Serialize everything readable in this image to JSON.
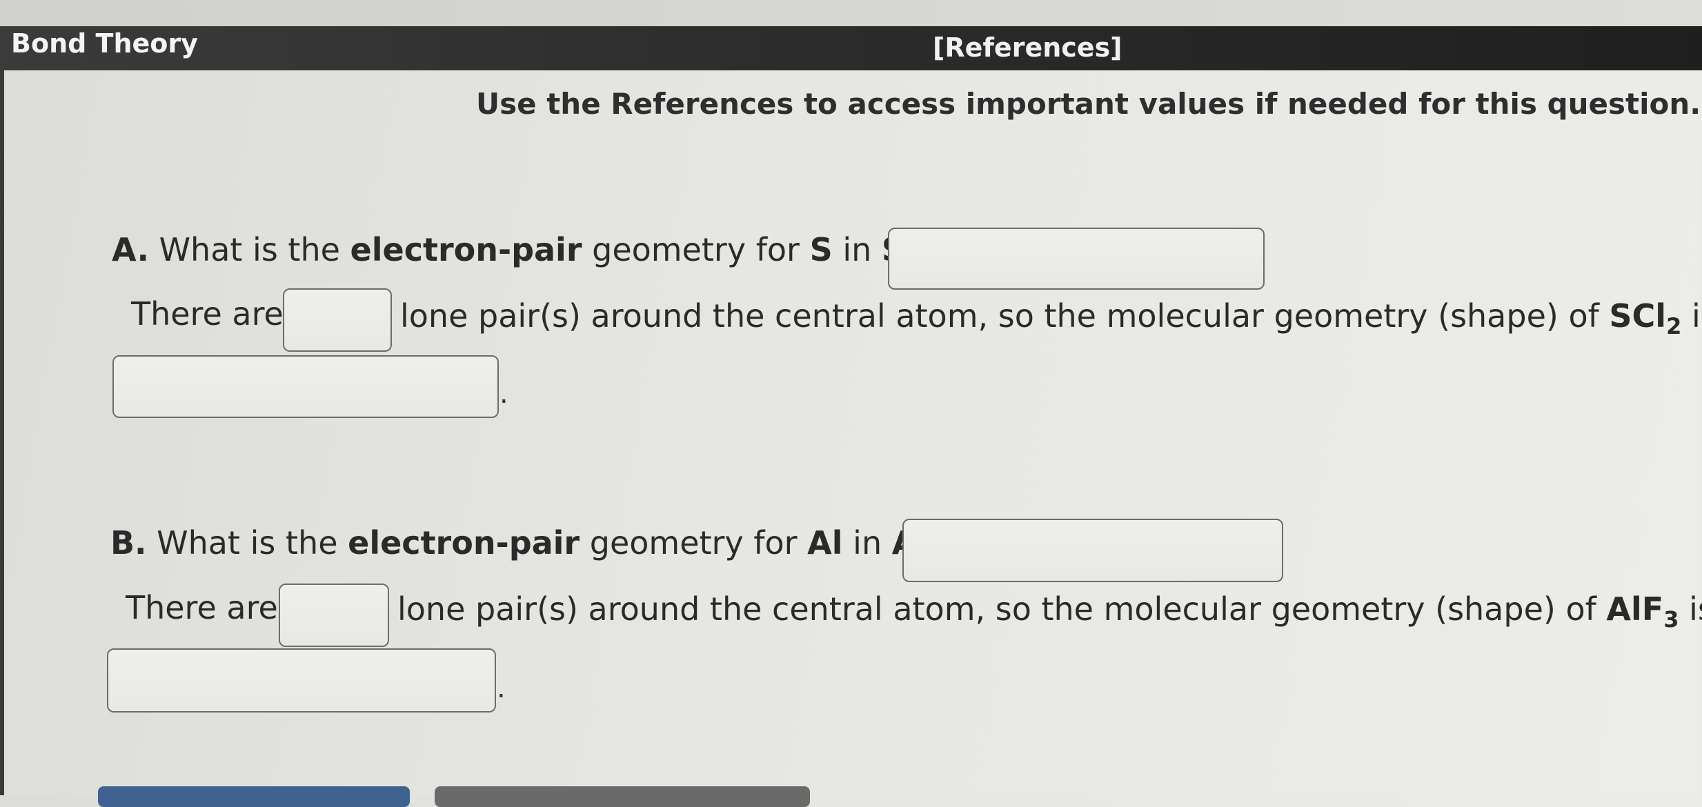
{
  "header": {
    "title": "Bond Theory",
    "references_link": "[References]"
  },
  "instructions": "Use the References to access important values if needed for this question.",
  "part_a": {
    "label": "A.",
    "q1_pre": "What is the",
    "q1_bold": "electron-pair",
    "q1_mid": "geometry for",
    "atom": "S",
    "q1_in": "in",
    "molecule": "SCl",
    "subscript": "2",
    "qmark": "?",
    "there_are": "There are",
    "lone_pairs_text": "lone pair(s) around the central atom, so the molecular geometry (shape) of",
    "is": "is",
    "period": "."
  },
  "part_b": {
    "label": "B.",
    "q1_pre": "What is the",
    "q1_bold": "electron-pair",
    "q1_mid": "geometry for",
    "atom": "Al",
    "q1_in": "in",
    "molecule": "AlF",
    "subscript": "3",
    "qmark": "?",
    "there_are": "There are",
    "lone_pairs_text": "lone pair(s) around the central atom, so the molecular geometry (shape) of",
    "is": "is",
    "period": "."
  },
  "colors": {
    "header_bg": "#2e2e2e",
    "page_bg": "#e6e6e2",
    "button_blue": "#3f6290",
    "button_gray": "#6a6a6a"
  }
}
